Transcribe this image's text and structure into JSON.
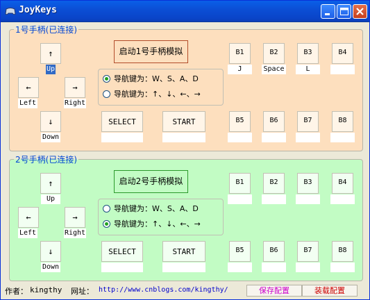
{
  "window": {
    "title": "JoyKeys"
  },
  "pads": [
    {
      "group_title": "1号手柄(已连接)",
      "start_label": "启动1号手柄模拟",
      "dpad": {
        "up": {
          "symbol": "↑",
          "value": "Up"
        },
        "left": {
          "symbol": "←",
          "value": "Left"
        },
        "right": {
          "symbol": "→",
          "value": "Right"
        },
        "down": {
          "symbol": "↓",
          "value": "Down"
        }
      },
      "nav_options": [
        {
          "label": "导航键为：W、S、A、D",
          "selected": true
        },
        {
          "label": "导航键为：↑、↓、←、→",
          "selected": false
        }
      ],
      "select": {
        "label": "SELECT",
        "value": ""
      },
      "start": {
        "label": "START",
        "value": ""
      },
      "buttons": [
        {
          "label": "B1",
          "value": "J"
        },
        {
          "label": "B2",
          "value": "Space"
        },
        {
          "label": "B3",
          "value": "L"
        },
        {
          "label": "B4",
          "value": ""
        },
        {
          "label": "B5",
          "value": ""
        },
        {
          "label": "B6",
          "value": ""
        },
        {
          "label": "B7",
          "value": ""
        },
        {
          "label": "B8",
          "value": ""
        }
      ]
    },
    {
      "group_title": "2号手柄(已连接)",
      "start_label": "启动2号手柄模拟",
      "dpad": {
        "up": {
          "symbol": "↑",
          "value": "Up"
        },
        "left": {
          "symbol": "←",
          "value": "Left"
        },
        "right": {
          "symbol": "→",
          "value": "Right"
        },
        "down": {
          "symbol": "↓",
          "value": "Down"
        }
      },
      "nav_options": [
        {
          "label": "导航键为：W、S、A、D",
          "selected": false
        },
        {
          "label": "导航键为：↑、↓、←、→",
          "selected": true
        }
      ],
      "select": {
        "label": "SELECT",
        "value": ""
      },
      "start": {
        "label": "START",
        "value": ""
      },
      "buttons": [
        {
          "label": "B1",
          "value": ""
        },
        {
          "label": "B2",
          "value": ""
        },
        {
          "label": "B3",
          "value": ""
        },
        {
          "label": "B4",
          "value": ""
        },
        {
          "label": "B5",
          "value": ""
        },
        {
          "label": "B6",
          "value": ""
        },
        {
          "label": "B7",
          "value": ""
        },
        {
          "label": "B8",
          "value": ""
        }
      ]
    }
  ],
  "footer": {
    "author_label": "作者：",
    "author": "kingthy",
    "site_label": "网址：",
    "site_url": "http://www.cnblogs.com/kingthy/",
    "save_button": "保存配置",
    "load_button": "装载配置"
  },
  "colors": {
    "pad1_bg": "#fddfbe",
    "pad2_bg": "#c2fcc4",
    "link": "#0000cc",
    "save": "#cc00cc",
    "load": "#cc0000"
  }
}
